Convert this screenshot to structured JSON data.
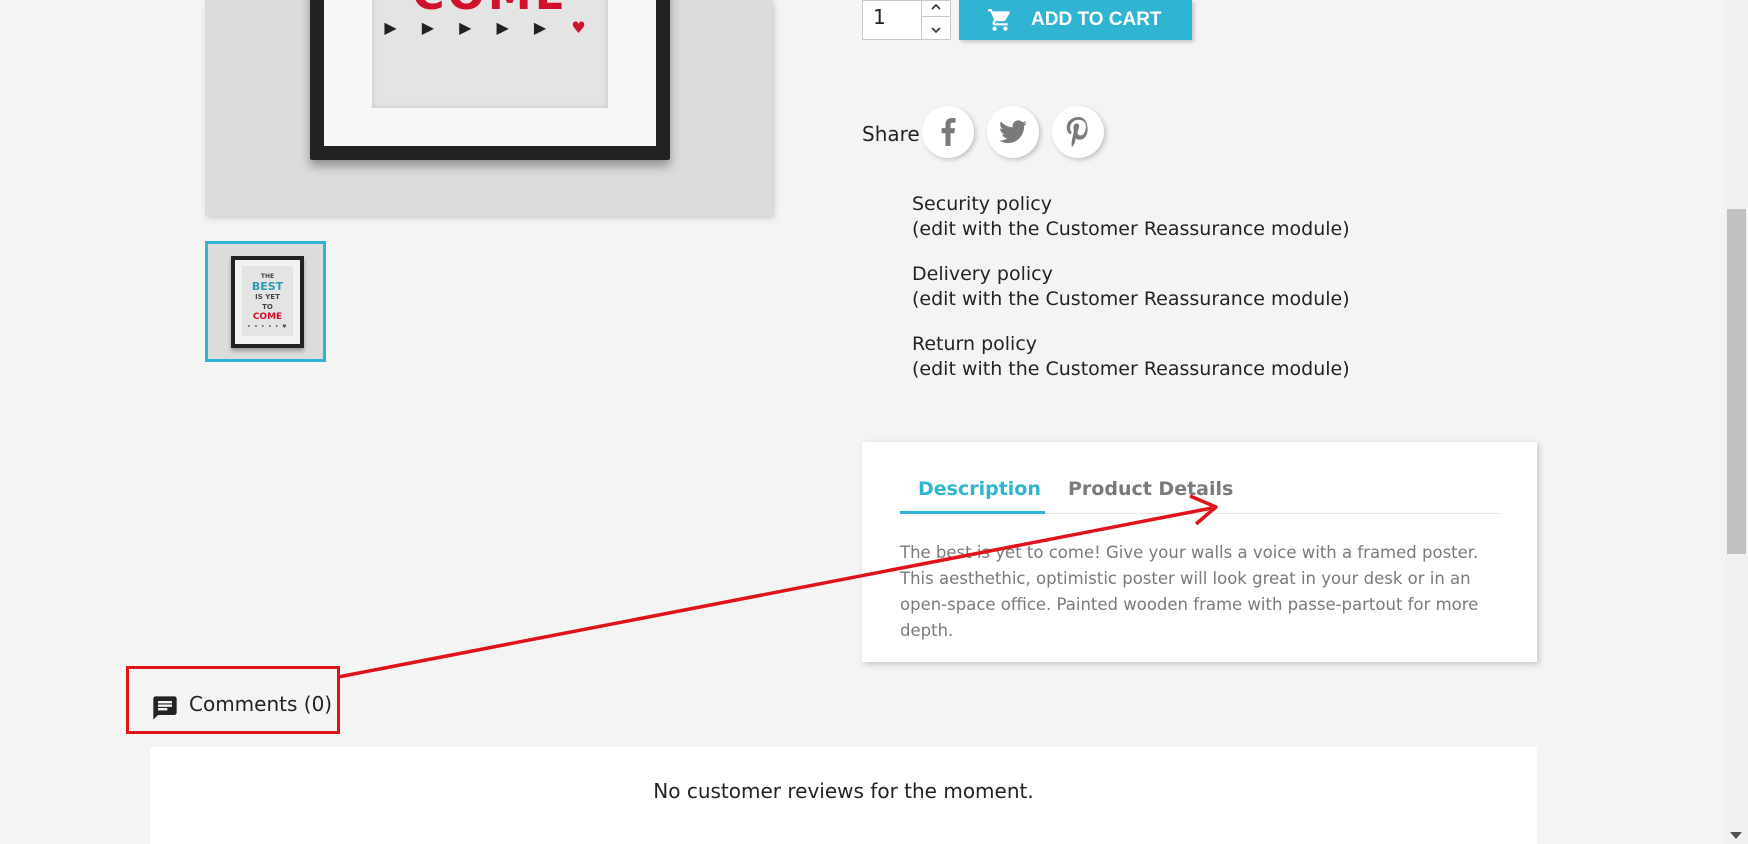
{
  "product": {
    "image_word": "COME",
    "image_marks": "▶ ▶ ▶ ▶ ▶",
    "image_heart": "♥",
    "thumb_lines": [
      "THE",
      "BEST",
      "IS YET",
      "TO",
      "COME",
      "• • • • • ♥"
    ]
  },
  "purchase": {
    "quantity": "1",
    "qty_up_icon": "chevron-up-icon",
    "qty_down_icon": "chevron-down-icon",
    "add_to_cart_label": "ADD TO CART",
    "accent_color": "#2fb5d2"
  },
  "share": {
    "label": "Share",
    "networks": [
      "facebook",
      "twitter",
      "pinterest"
    ]
  },
  "reassurance": [
    {
      "title": "Security policy",
      "note": "(edit with the Customer Reassurance module)"
    },
    {
      "title": "Delivery policy",
      "note": "(edit with the Customer Reassurance module)"
    },
    {
      "title": "Return policy",
      "note": "(edit with the Customer Reassurance module)"
    }
  ],
  "tabs": {
    "items": [
      {
        "label": "Description",
        "active": true
      },
      {
        "label": "Product Details",
        "active": false
      }
    ],
    "description": "The best is yet to come! Give your walls a voice with a framed poster. This aesthethic, optimistic poster will look great in your desk or in an open-space office. Painted wooden frame with passe-partout for more depth."
  },
  "comments": {
    "label": "Comments (0)",
    "empty_message": "No customer reviews for the moment.",
    "highlight_color": "#e0131b"
  }
}
